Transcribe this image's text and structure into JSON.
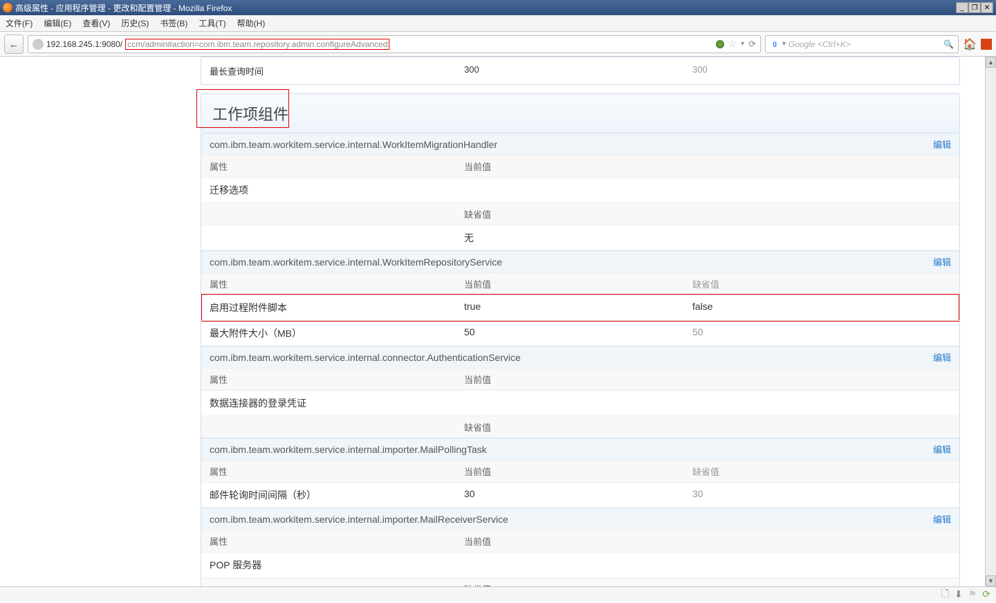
{
  "window": {
    "title": "高级属性 - 应用程序管理 - 更改和配置管理 - Mozilla Firefox",
    "min": "_",
    "restore": "❐",
    "close": "✕"
  },
  "menu": {
    "file": "文件(F)",
    "edit": "编辑(E)",
    "view": "查看(V)",
    "history": "历史(S)",
    "bookmarks": "书签(B)",
    "tools": "工具(T)",
    "help": "帮助(H)"
  },
  "nav": {
    "back": "←",
    "url_host": "192.168.245.1:9080/",
    "url_path": "ccm/admin#action=com.ibm.team.repository.admin.configureAdvanced",
    "star": "☆",
    "dd": "▾",
    "reload": "⟳",
    "home": "🏠",
    "search_placeholder": "Google <Ctrl+K>",
    "mag": "🔍"
  },
  "top": {
    "label": "最长查询时间",
    "current": "300",
    "default": "300"
  },
  "section_title": "工作项组件",
  "labels": {
    "attr": "属性",
    "current": "当前值",
    "default": "缺省值",
    "edit": "编辑",
    "none": "无"
  },
  "svc1": {
    "name": "com.ibm.team.workitem.service.internal.WorkItemMigrationHandler",
    "row1_attr": "迁移选项"
  },
  "svc2": {
    "name": "com.ibm.team.workitem.service.internal.WorkItemRepositoryService",
    "row1_attr": "启用过程附件脚本",
    "row1_cur": "true",
    "row1_def": "false",
    "row2_attr": "最大附件大小（MB）",
    "row2_cur": "50",
    "row2_def": "50"
  },
  "svc3": {
    "name": "com.ibm.team.workitem.service.internal.connector.AuthenticationService",
    "row1_attr": "数据连接器的登录凭证"
  },
  "svc4": {
    "name": "com.ibm.team.workitem.service.internal.importer.MailPollingTask",
    "row1_attr": "邮件轮询时间间隔（秒）",
    "row1_cur": "30",
    "row1_def": "30"
  },
  "svc5": {
    "name": "com.ibm.team.workitem.service.internal.importer.MailReceiverService",
    "row1_attr": "POP 服务器"
  }
}
